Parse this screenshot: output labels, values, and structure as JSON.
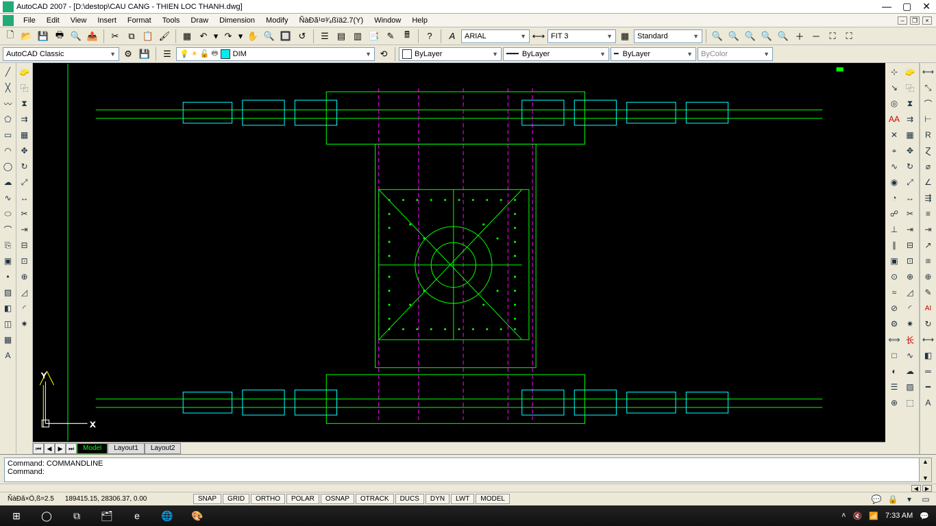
{
  "window": {
    "title": "AutoCAD 2007 - [D:\\destop\\CAU CANG - THIEN LOC THANH.dwg]"
  },
  "menu": {
    "items": [
      "File",
      "Edit",
      "View",
      "Insert",
      "Format",
      "Tools",
      "Draw",
      "Dimension",
      "Modify",
      "ÑàÐã¹¤³⁄₄ßïä2.7(Y)",
      "Window",
      "Help"
    ]
  },
  "toolbar": {
    "standard": [
      "new",
      "open",
      "save",
      "plot",
      "plot-preview",
      "publish",
      "cut",
      "copy",
      "paste",
      "match",
      "block-editor",
      "undo",
      "redo",
      "pan",
      "zoom-rt",
      "zoom-win",
      "zoom-prev",
      "properties",
      "design-center",
      "tool-palettes",
      "sheet-set",
      "markup",
      "qcalc",
      "help"
    ],
    "workspace": {
      "label": "AutoCAD Classic"
    },
    "layer_current": "DIM",
    "styles": {
      "text_style": "ARIAL",
      "dim_style": "FIT 3",
      "table_style": "Standard"
    },
    "props": {
      "color": "ByLayer",
      "linetype": "ByLayer",
      "lineweight": "ByLayer",
      "plotstyle": "ByColor"
    },
    "zoom_icons": [
      "zoom-window",
      "zoom-dynamic",
      "zoom-scale",
      "zoom-center",
      "zoom-object",
      "zoom-in",
      "zoom-out",
      "zoom-all",
      "zoom-extents"
    ]
  },
  "draw_tools": [
    "line",
    "construction-line",
    "polyline",
    "polygon",
    "rectangle",
    "arc",
    "circle",
    "revision-cloud",
    "spline",
    "ellipse",
    "ellipse-arc",
    "insert-block",
    "make-block",
    "point",
    "hatch",
    "gradient",
    "region",
    "table",
    "multiline-text"
  ],
  "modify_tools": [
    "erase",
    "copy",
    "mirror",
    "offset",
    "array",
    "move",
    "rotate",
    "scale",
    "stretch",
    "trim",
    "extend",
    "break-at-point",
    "break",
    "join",
    "chamfer",
    "fillet",
    "explode"
  ],
  "right_panel_a": [
    "distance",
    "area",
    "region-mass",
    "list",
    "id",
    "temporary-track",
    "snap-from",
    "endpoint",
    "midpoint",
    "intersection",
    "apparent-int",
    "extension",
    "center",
    "quadrant",
    "tangent",
    "perpendicular",
    "parallel",
    "insert",
    "node",
    "nearest",
    "none",
    "osnap-settings"
  ],
  "right_panel_b": [
    "dim-linear",
    "dim-aligned",
    "dim-arc",
    "dim-ordinate",
    "dim-radius",
    "dim-jogged",
    "dim-diameter",
    "dim-angular",
    "quick-dim",
    "dim-baseline",
    "dim-continue",
    "quick-leader",
    "tolerance",
    "center-mark",
    "dim-edit",
    "dim-text-edit",
    "dim-update",
    "dim-style",
    "match-properties",
    "layer",
    "layer-previous",
    "linetype",
    "lineweight",
    "color",
    "dim-override",
    "text-style",
    "scale-list"
  ],
  "layout": {
    "tabs": [
      "Model",
      "Layout1",
      "Layout2"
    ],
    "active": "Model"
  },
  "command": {
    "line1": "Command: COMMANDLINE",
    "line2": "Command:"
  },
  "status": {
    "plugin": "ÑàÐã×Ö,ß=2.5",
    "coords": "189415.15, 28306.37, 0.00",
    "toggles": [
      "SNAP",
      "GRID",
      "ORTHO",
      "POLAR",
      "OSNAP",
      "OTRACK",
      "DUCS",
      "DYN",
      "LWT",
      "MODEL"
    ]
  },
  "taskbar": {
    "apps": [
      "start",
      "cortana",
      "task-view",
      "file-explorer",
      "edge",
      "chrome",
      "paint",
      "autocad"
    ],
    "time": "7:33 AM"
  }
}
